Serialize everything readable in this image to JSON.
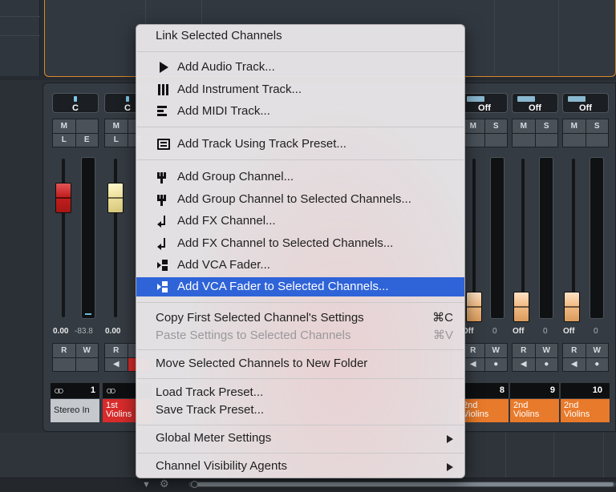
{
  "mixer": {
    "strips": [
      {
        "pan": "C",
        "buttons": [
          "M",
          "",
          "L",
          "E"
        ],
        "fader_color": "red",
        "value1": "0.00",
        "value2": "-83.8",
        "rw": [
          "R",
          "W",
          "",
          ""
        ],
        "number": "1",
        "name_line1": "Stereo In",
        "name_line2": "",
        "name_color": "grey"
      },
      {
        "pan": "C",
        "buttons": [
          "M",
          "",
          "L",
          "E"
        ],
        "fader_color": "yellow",
        "value1": "0.00",
        "value2": "",
        "rw": [
          "R",
          "",
          "◀",
          ""
        ],
        "number": "",
        "name_line1": "1st",
        "name_line2": "Violins",
        "name_color": "red"
      },
      {
        "pan": "Off",
        "buttons": [
          "M",
          "S",
          "",
          ""
        ],
        "fader_color": "peach",
        "value1": "Off",
        "value2": "0",
        "rw": [
          "R",
          "W",
          "◀",
          "●"
        ],
        "number": "8",
        "name_line1": "2nd",
        "name_line2": "Violins",
        "name_color": "orange"
      },
      {
        "pan": "Off",
        "buttons": [
          "M",
          "S",
          "",
          ""
        ],
        "fader_color": "peach",
        "value1": "Off",
        "value2": "0",
        "rw": [
          "R",
          "W",
          "◀",
          "●"
        ],
        "number": "9",
        "name_line1": "2nd",
        "name_line2": "Violins",
        "name_color": "orange"
      },
      {
        "pan": "Off",
        "buttons": [
          "M",
          "S",
          "",
          ""
        ],
        "fader_color": "peach",
        "value1": "Off",
        "value2": "0",
        "rw": [
          "R",
          "W",
          "◀",
          "●"
        ],
        "number": "10",
        "name_line1": "2nd",
        "name_line2": "Violins",
        "name_color": "orange"
      }
    ]
  },
  "menu": {
    "items": [
      {
        "label": "Link Selected Channels",
        "icon": "",
        "shortcut": "",
        "submenu": false,
        "disabled": false
      },
      {
        "label": "Add Audio Track...",
        "icon": "audio-track-icon",
        "shortcut": "",
        "submenu": false,
        "disabled": false
      },
      {
        "label": "Add Instrument Track...",
        "icon": "instrument-track-icon",
        "shortcut": "",
        "submenu": false,
        "disabled": false
      },
      {
        "label": "Add MIDI Track...",
        "icon": "midi-track-icon",
        "shortcut": "",
        "submenu": false,
        "disabled": false
      },
      {
        "label": "Add Track Using Track Preset...",
        "icon": "track-preset-icon",
        "shortcut": "",
        "submenu": false,
        "disabled": false
      },
      {
        "label": "Add Group Channel...",
        "icon": "group-channel-icon",
        "shortcut": "",
        "submenu": false,
        "disabled": false
      },
      {
        "label": "Add Group Channel to Selected Channels...",
        "icon": "group-channel-icon",
        "shortcut": "",
        "submenu": false,
        "disabled": false
      },
      {
        "label": "Add FX Channel...",
        "icon": "fx-channel-icon",
        "shortcut": "",
        "submenu": false,
        "disabled": false
      },
      {
        "label": "Add FX Channel to Selected Channels...",
        "icon": "fx-channel-icon",
        "shortcut": "",
        "submenu": false,
        "disabled": false
      },
      {
        "label": "Add VCA Fader...",
        "icon": "vca-fader-icon",
        "shortcut": "",
        "submenu": false,
        "disabled": false
      },
      {
        "label": "Add VCA Fader to Selected Channels...",
        "icon": "vca-fader-icon",
        "shortcut": "",
        "submenu": false,
        "disabled": false,
        "highlighted": true
      },
      {
        "label": "Copy First Selected Channel's Settings",
        "icon": "",
        "shortcut": "⌘C",
        "submenu": false,
        "disabled": false
      },
      {
        "label": "Paste Settings to Selected Channels",
        "icon": "",
        "shortcut": "⌘V",
        "submenu": false,
        "disabled": true
      },
      {
        "label": "Move Selected Channels to New Folder",
        "icon": "",
        "shortcut": "",
        "submenu": false,
        "disabled": false
      },
      {
        "label": "Load Track Preset...",
        "icon": "",
        "shortcut": "",
        "submenu": false,
        "disabled": false
      },
      {
        "label": "Save Track Preset...",
        "icon": "",
        "shortcut": "",
        "submenu": false,
        "disabled": false
      },
      {
        "label": "Global Meter Settings",
        "icon": "",
        "shortcut": "",
        "submenu": true,
        "disabled": false
      },
      {
        "label": "Channel Visibility Agents",
        "icon": "",
        "shortcut": "",
        "submenu": true,
        "disabled": false
      }
    ]
  },
  "colors": {
    "highlight": "#2f63d8",
    "fader_red": "#c41f1f",
    "name_red": "#d92b2b",
    "name_orange": "#e87a2b",
    "frame_orange": "#d7892c"
  }
}
